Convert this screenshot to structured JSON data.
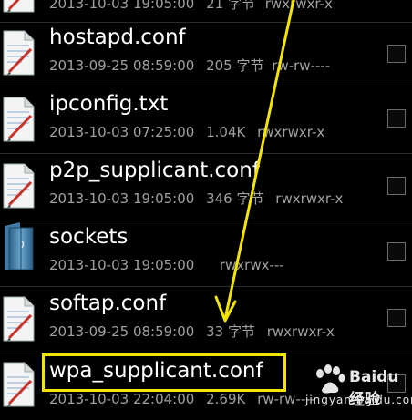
{
  "files": [
    {
      "name": "",
      "date": "2013-10-03 19:05:00",
      "size": "21 字节",
      "perm": "rwxrwxr-x",
      "icon": "text-file-icon"
    },
    {
      "name": "hostapd.conf",
      "date": "2013-09-25 08:59:00",
      "size": "205 字节",
      "perm": "rw-rw----",
      "icon": "text-file-icon"
    },
    {
      "name": "ipconfig.txt",
      "date": "2013-10-03 07:25:00",
      "size": "1.04K",
      "perm": "rwxrwxr-x",
      "icon": "text-file-icon"
    },
    {
      "name": "p2p_supplicant.conf",
      "date": "2013-10-03 19:05:00",
      "size": "346 字节",
      "perm": "rwxrwxr-x",
      "icon": "text-file-icon"
    },
    {
      "name": "sockets",
      "date": "2013-10-03 19:05:00",
      "size": "",
      "perm": "rwxrwx---",
      "icon": "folder-icon"
    },
    {
      "name": "softap.conf",
      "date": "2013-09-25 08:59:00",
      "size": "33 字节",
      "perm": "rwxrwxr-x",
      "icon": "text-file-icon"
    },
    {
      "name": "wpa_supplicant.conf",
      "date": "2013-10-03 22:04:00",
      "size": "2.69K",
      "perm": "rw-rw----",
      "icon": "text-file-icon"
    }
  ],
  "watermark": {
    "brand": "Baidu 经验",
    "site": "jingyan.baidu.com"
  },
  "colors": {
    "highlight": "#f4e600",
    "arrow": "#f4e600",
    "background": "#000000",
    "name_text": "#ffffff",
    "meta_text": "#a0a0a0"
  }
}
